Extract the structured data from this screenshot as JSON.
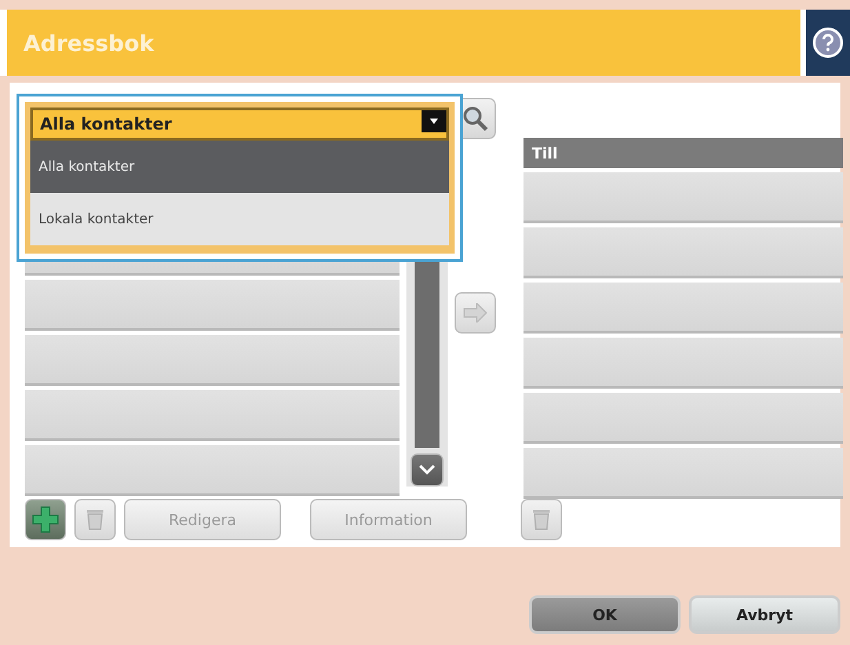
{
  "header": {
    "title": "Adressbok"
  },
  "contact_filter": {
    "value": "Alla kontakter",
    "options": [
      {
        "label": "Alla kontakter",
        "selected": true
      },
      {
        "label": "Lokala kontakter",
        "selected": false
      }
    ]
  },
  "recipients": {
    "header": "Till"
  },
  "list_buttons": [
    {
      "label": "Redigera",
      "disabled": true
    },
    {
      "label": "Information",
      "disabled": true
    }
  ],
  "footer_buttons": [
    {
      "label": "OK",
      "kind": "primary"
    },
    {
      "label": "Avbryt",
      "kind": "secondary"
    }
  ]
}
